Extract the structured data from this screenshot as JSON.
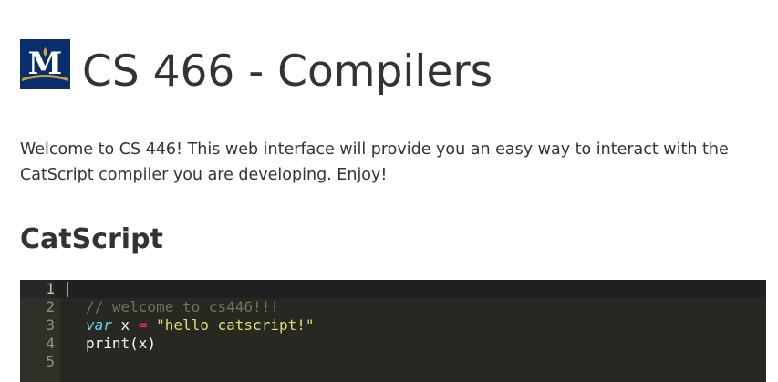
{
  "header": {
    "logo_letter": "M",
    "title": "CS 466 - Compilers"
  },
  "intro": {
    "text": "Welcome to CS 446! This web interface will provide you an easy way to interact with the CatScript compiler you are developing. Enjoy!"
  },
  "section": {
    "title": "CatScript"
  },
  "editor": {
    "lines": [
      {
        "number": "1",
        "tokens": []
      },
      {
        "number": "2",
        "tokens": [
          {
            "type": "comment",
            "text": "// welcome to cs446!!!"
          }
        ]
      },
      {
        "number": "3",
        "tokens": [
          {
            "type": "keyword",
            "text": "var"
          },
          {
            "type": "plain",
            "text": " x "
          },
          {
            "type": "op",
            "text": "="
          },
          {
            "type": "plain",
            "text": " "
          },
          {
            "type": "string",
            "text": "\"hello catscript!\""
          }
        ]
      },
      {
        "number": "4",
        "tokens": [
          {
            "type": "plain",
            "text": "print(x)"
          }
        ]
      },
      {
        "number": "5",
        "tokens": []
      }
    ],
    "colors": {
      "background": "#272822",
      "comment": "#75715e",
      "keyword": "#66d9ef",
      "operator": "#f92672",
      "string": "#e6db74"
    }
  },
  "colors": {
    "logo_background": "#0a2d6b",
    "logo_gold": "#c8a23a",
    "text": "#333333"
  }
}
